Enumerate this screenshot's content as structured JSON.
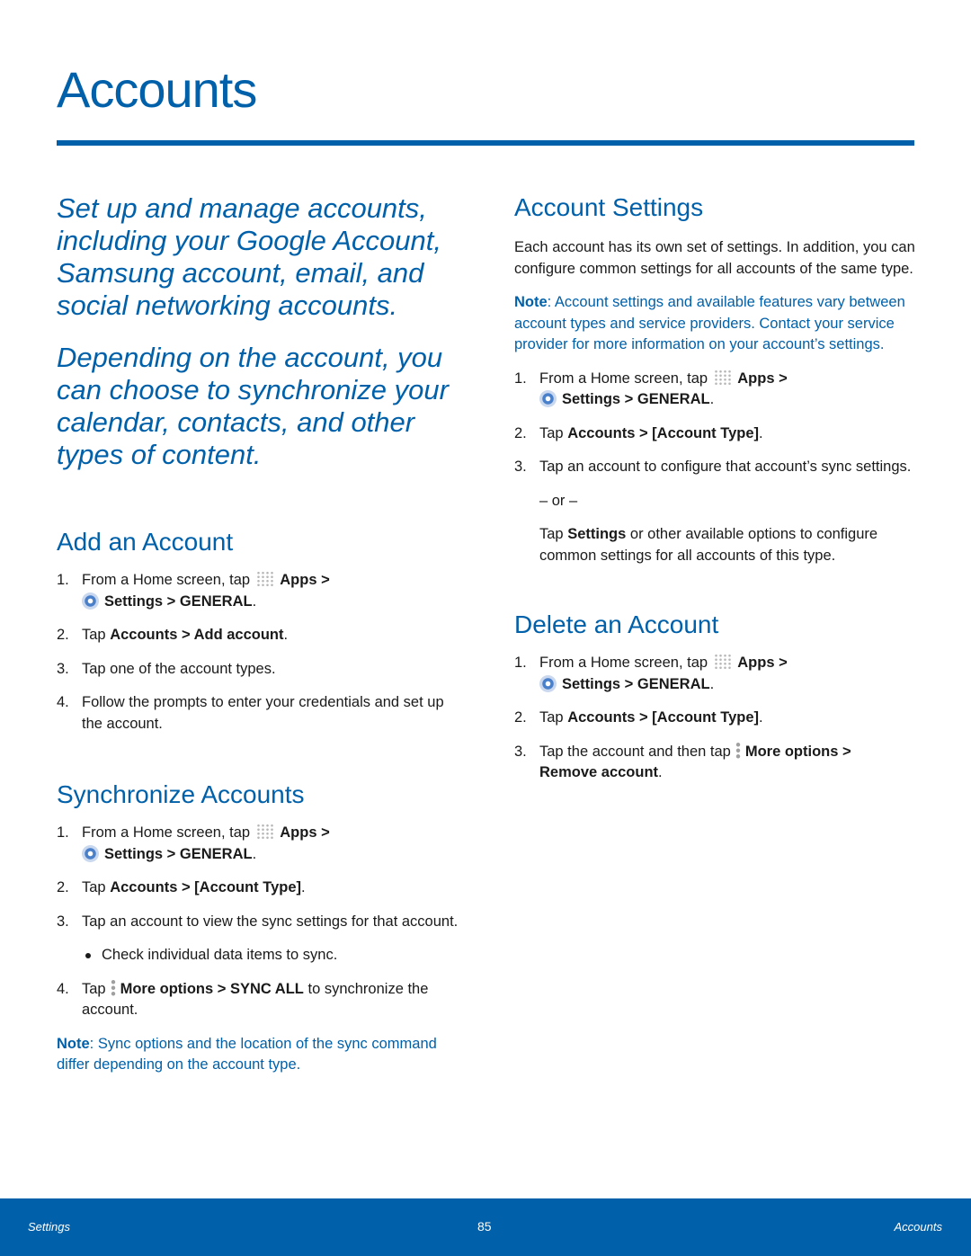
{
  "page": {
    "title": "Accounts",
    "intro_1": "Set up and manage accounts, including your Google Account, Samsung account, email, and social networking accounts.",
    "intro_2": "Depending on the account, you can choose to synchronize your calendar, contacts, and other types of content."
  },
  "common": {
    "step_home_prefix": "From a Home screen, tap",
    "apps": "Apps >",
    "settings_general": "Settings > GENERAL",
    "tap": "Tap",
    "accounts_type": "Accounts > [Account Type]",
    "more_options": "More options >",
    "period": "."
  },
  "add_account": {
    "heading": "Add an Account",
    "step2_bold": "Accounts > Add account",
    "step3": "Tap one of the account types.",
    "step4": "Follow the prompts to enter your credentials and set up the account."
  },
  "sync_accounts": {
    "heading": "Synchronize Accounts",
    "step3": "Tap an account to view the sync settings for that account.",
    "bullet": "Check individual data items to sync.",
    "step4_bold": "More options > SYNC ALL",
    "step4_rest": "to synchronize the account.",
    "note_label": "Note",
    "note_text": ": Sync options and the location of the sync command differ depending on the account type."
  },
  "account_settings": {
    "heading": "Account Settings",
    "para": "Each account has its own set of settings. In addition, you can configure common settings for all accounts of the same type.",
    "note_label": "Note",
    "note_text": ": Account settings and available features vary between account types and service providers. Contact your service provider for more information on your account’s settings.",
    "step3": "Tap an account to configure that account’s sync settings.",
    "or": "– or –",
    "alt_bold": "Settings",
    "alt_rest": "or other available options to configure common settings for all accounts of this type."
  },
  "delete_account": {
    "heading": "Delete an Account",
    "step3_prefix": "Tap the account and then tap",
    "step3_bold2": "Remove account"
  },
  "numbers": [
    "1.",
    "2.",
    "3.",
    "4."
  ],
  "footer": {
    "left": "Settings",
    "page_number": "85",
    "right": "Accounts"
  }
}
